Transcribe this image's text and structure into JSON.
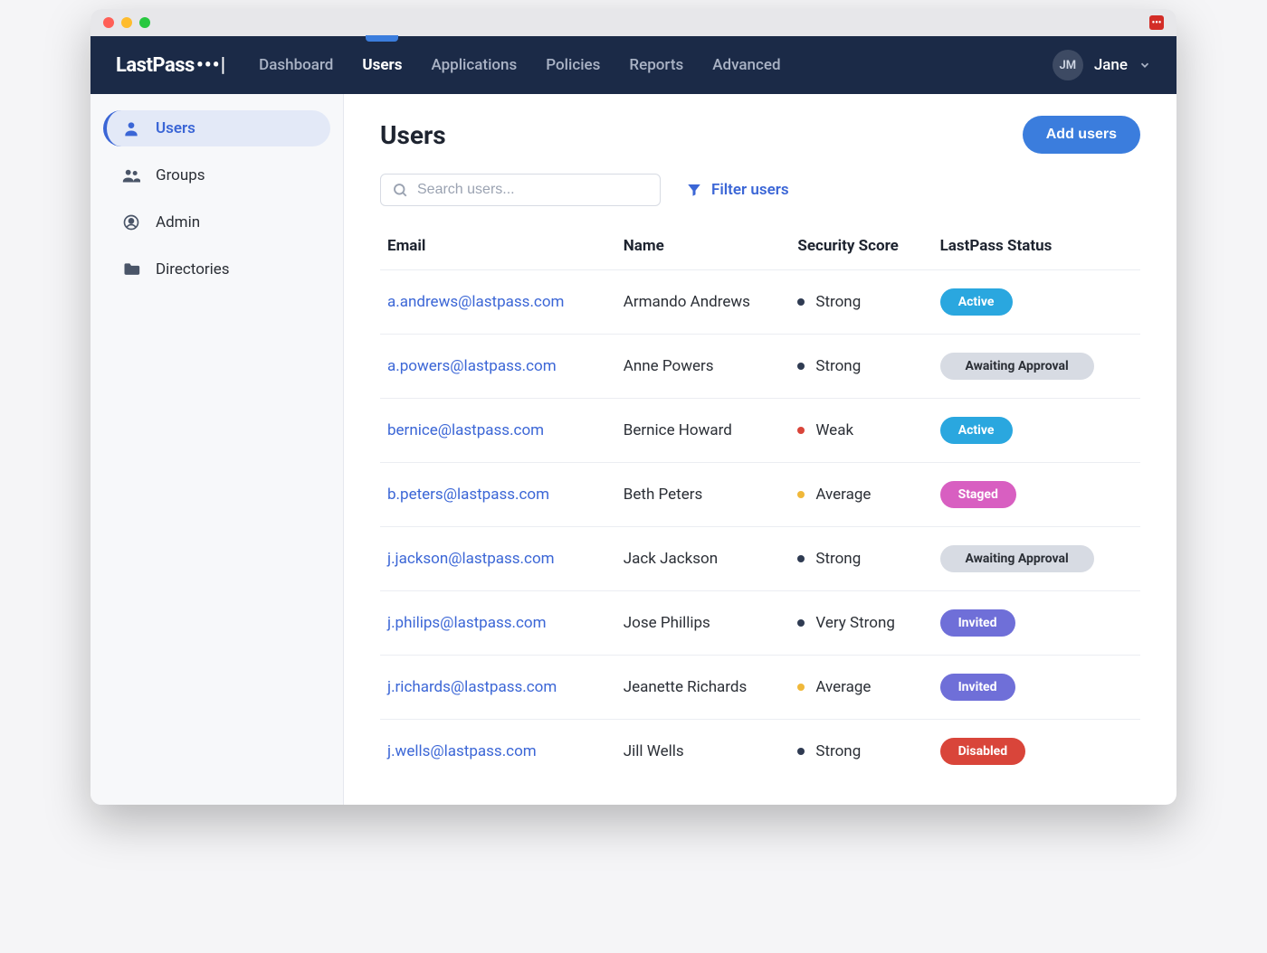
{
  "brand": {
    "name": "LastPass",
    "dots": "•••|"
  },
  "nav": {
    "items": [
      "Dashboard",
      "Users",
      "Applications",
      "Policies",
      "Reports",
      "Advanced"
    ],
    "active": 1
  },
  "user": {
    "initials": "JM",
    "name": "Jane"
  },
  "sidebar": {
    "items": [
      {
        "label": "Users",
        "icon": "user-icon",
        "active": true
      },
      {
        "label": "Groups",
        "icon": "users-icon",
        "active": false
      },
      {
        "label": "Admin",
        "icon": "admin-icon",
        "active": false
      },
      {
        "label": "Directories",
        "icon": "folder-icon",
        "active": false
      }
    ]
  },
  "page": {
    "title": "Users",
    "add_button": "Add users",
    "search_placeholder": "Search users...",
    "filter_label": "Filter users"
  },
  "columns": [
    "Email",
    "Name",
    "Security Score",
    "LastPass Status"
  ],
  "score_colors": {
    "Strong": "#2f3b52",
    "Very Strong": "#2f3b52",
    "Average": "#f0b83a",
    "Weak": "#d9453a"
  },
  "status_styles": {
    "Active": {
      "bg": "#2aa7df",
      "fg": "#ffffff",
      "wide": false
    },
    "Awaiting Approval": {
      "bg": "#d7dbe3",
      "fg": "#2b2f36",
      "wide": true
    },
    "Staged": {
      "bg": "#d85fc1",
      "fg": "#ffffff",
      "wide": false
    },
    "Invited": {
      "bg": "#6f6fd8",
      "fg": "#ffffff",
      "wide": false
    },
    "Disabled": {
      "bg": "#d9453a",
      "fg": "#ffffff",
      "wide": false
    }
  },
  "rows": [
    {
      "email": "a.andrews@lastpass.com",
      "name": "Armando Andrews",
      "score": "Strong",
      "status": "Active"
    },
    {
      "email": "a.powers@lastpass.com",
      "name": "Anne Powers",
      "score": "Strong",
      "status": "Awaiting Approval"
    },
    {
      "email": "bernice@lastpass.com",
      "name": "Bernice Howard",
      "score": "Weak",
      "status": "Active"
    },
    {
      "email": "b.peters@lastpass.com",
      "name": "Beth Peters",
      "score": "Average",
      "status": "Staged"
    },
    {
      "email": "j.jackson@lastpass.com",
      "name": "Jack Jackson",
      "score": "Strong",
      "status": "Awaiting Approval"
    },
    {
      "email": "j.philips@lastpass.com",
      "name": "Jose Phillips",
      "score": "Very Strong",
      "status": "Invited"
    },
    {
      "email": "j.richards@lastpass.com",
      "name": "Jeanette Richards",
      "score": "Average",
      "status": "Invited"
    },
    {
      "email": "j.wells@lastpass.com",
      "name": "Jill Wells",
      "score": "Strong",
      "status": "Disabled"
    }
  ]
}
